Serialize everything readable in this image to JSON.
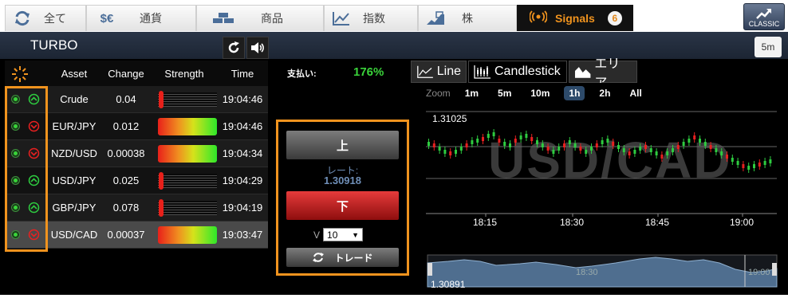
{
  "tabs": [
    {
      "label": "全て",
      "icon": "refresh-icon"
    },
    {
      "label": "通貨",
      "icon": "currency-icon"
    },
    {
      "label": "商品",
      "icon": "gold-bars-icon"
    },
    {
      "label": "指数",
      "icon": "line-chart-icon"
    },
    {
      "label": "株",
      "icon": "stock-icon"
    }
  ],
  "signals": {
    "label": "Signals",
    "count": "6",
    "icon": "broadcast-icon"
  },
  "classic": {
    "label": "CLASSIC",
    "icon": "trend-icon"
  },
  "panel": {
    "title": "TURBO",
    "timeframe": "5m"
  },
  "table": {
    "headers": {
      "asset": "Asset",
      "change": "Change",
      "strength": "Strength",
      "time": "Time"
    },
    "rows": [
      {
        "asset": "Crude",
        "change": "0.04",
        "time": "19:04:46",
        "direction": "up",
        "strength": 0.0
      },
      {
        "asset": "EUR/JPY",
        "change": "0.012",
        "time": "19:04:46",
        "direction": "down",
        "strength": 1.0
      },
      {
        "asset": "NZD/USD",
        "change": "0.00038",
        "time": "19:04:34",
        "direction": "down",
        "strength": 1.0
      },
      {
        "asset": "USD/JPY",
        "change": "0.025",
        "time": "19:04:29",
        "direction": "up",
        "strength": 0.0
      },
      {
        "asset": "GBP/JPY",
        "change": "0.078",
        "time": "19:04:19",
        "direction": "up",
        "strength": 0.0
      },
      {
        "asset": "USD/CAD",
        "change": "0.00037",
        "time": "19:03:47",
        "direction": "down",
        "strength": 1.0
      }
    ]
  },
  "payout": {
    "label": "支払い:",
    "value": "176%"
  },
  "trade": {
    "up_label": "上",
    "rate_label": "レート:",
    "rate_value": "1.30918",
    "down_label": "下",
    "amount_prefix": "V",
    "amount_value": "10",
    "trade_label": "トレード"
  },
  "chart_tabs": [
    {
      "label": "Line",
      "icon": "line-chart-icon"
    },
    {
      "label": "Candlestick",
      "icon": "candlestick-icon"
    },
    {
      "label": "エリア",
      "icon": "area-chart-icon"
    }
  ],
  "zoom": {
    "label": "Zoom",
    "options": [
      "1m",
      "5m",
      "10m",
      "1h",
      "2h",
      "All"
    ],
    "active": "1h"
  },
  "chart_data": {
    "type": "candlestick",
    "symbol": "USD/CAD",
    "price_high_label": "1.31025",
    "price_low_label": "1.30891",
    "x_ticks": [
      "18:15",
      "18:30",
      "18:45",
      "19:00"
    ],
    "navigator_ticks": [
      "18:30",
      "19:00"
    ],
    "grid": true
  },
  "colors": {
    "accent": "#f0931e",
    "up": "#2ecc40",
    "down": "#e82020",
    "payout": "#3ad33a"
  }
}
